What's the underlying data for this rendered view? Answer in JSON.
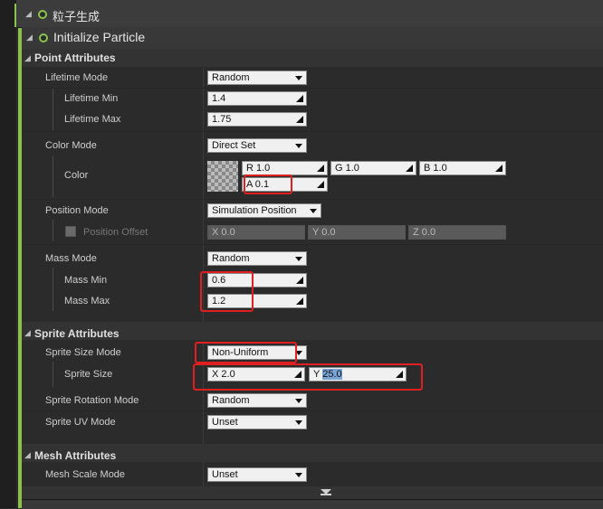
{
  "header": {
    "emitter_title": "粒子生成",
    "module_title": "Initialize Particle"
  },
  "sections": {
    "point": "Point Attributes",
    "sprite": "Sprite Attributes",
    "mesh": "Mesh Attributes"
  },
  "point": {
    "lifetime_mode_label": "Lifetime Mode",
    "lifetime_mode_value": "Random",
    "lifetime_min_label": "Lifetime Min",
    "lifetime_min_value": "1.4",
    "lifetime_max_label": "Lifetime Max",
    "lifetime_max_value": "1.75",
    "color_mode_label": "Color Mode",
    "color_mode_value": "Direct Set",
    "color_label": "Color",
    "color_r": "R 1.0",
    "color_g": "G 1.0",
    "color_b": "B 1.0",
    "color_a": "A 0.1",
    "position_mode_label": "Position Mode",
    "position_mode_value": "Simulation Position",
    "position_offset_label": "Position Offset",
    "pos_x": "X 0.0",
    "pos_y": "Y 0.0",
    "pos_z": "Z 0.0",
    "mass_mode_label": "Mass Mode",
    "mass_mode_value": "Random",
    "mass_min_label": "Mass Min",
    "mass_min_value": "0.6",
    "mass_max_label": "Mass Max",
    "mass_max_value": "1.2"
  },
  "sprite": {
    "size_mode_label": "Sprite Size Mode",
    "size_mode_value": "Non-Uniform",
    "size_label": "Sprite Size",
    "size_x": "X 2.0",
    "size_y_prefix": "Y",
    "size_y_value": "25.0",
    "rotation_mode_label": "Sprite Rotation Mode",
    "rotation_mode_value": "Random",
    "uv_mode_label": "Sprite UV Mode",
    "uv_mode_value": "Unset"
  },
  "mesh": {
    "scale_mode_label": "Mesh Scale Mode",
    "scale_mode_value": "Unset"
  },
  "colors": {
    "accent_green": "#8bc34a",
    "highlight_red": "#e02020",
    "selection_blue": "#7aa3d6"
  }
}
